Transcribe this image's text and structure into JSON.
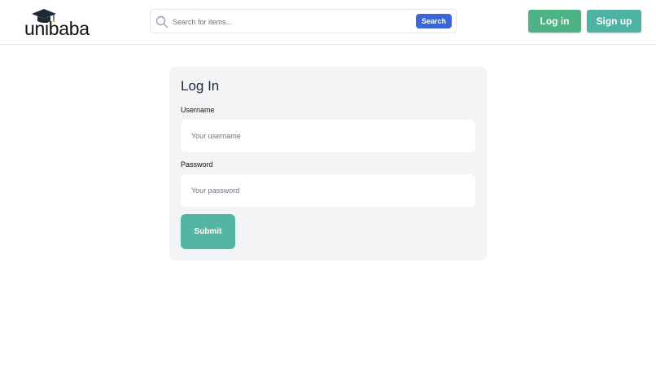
{
  "header": {
    "logo_text": "unibaba",
    "search": {
      "placeholder": "Search for items...",
      "value": "",
      "button_label": "Search"
    },
    "login_label": "Log in",
    "signup_label": "Sign up"
  },
  "login_form": {
    "title": "Log In",
    "username_label": "Username",
    "username_placeholder": "Your username",
    "password_label": "Password",
    "password_placeholder": "Your password",
    "submit_label": "Submit"
  },
  "colors": {
    "login_button": "#4fb285",
    "signup_button": "#4fb3a3",
    "search_button": "#3b67d6",
    "submit_button": "#55b5a3",
    "card_background": "#f3f4f6"
  },
  "icons": {
    "logo": "graduation-cap-icon",
    "search": "search-icon"
  }
}
